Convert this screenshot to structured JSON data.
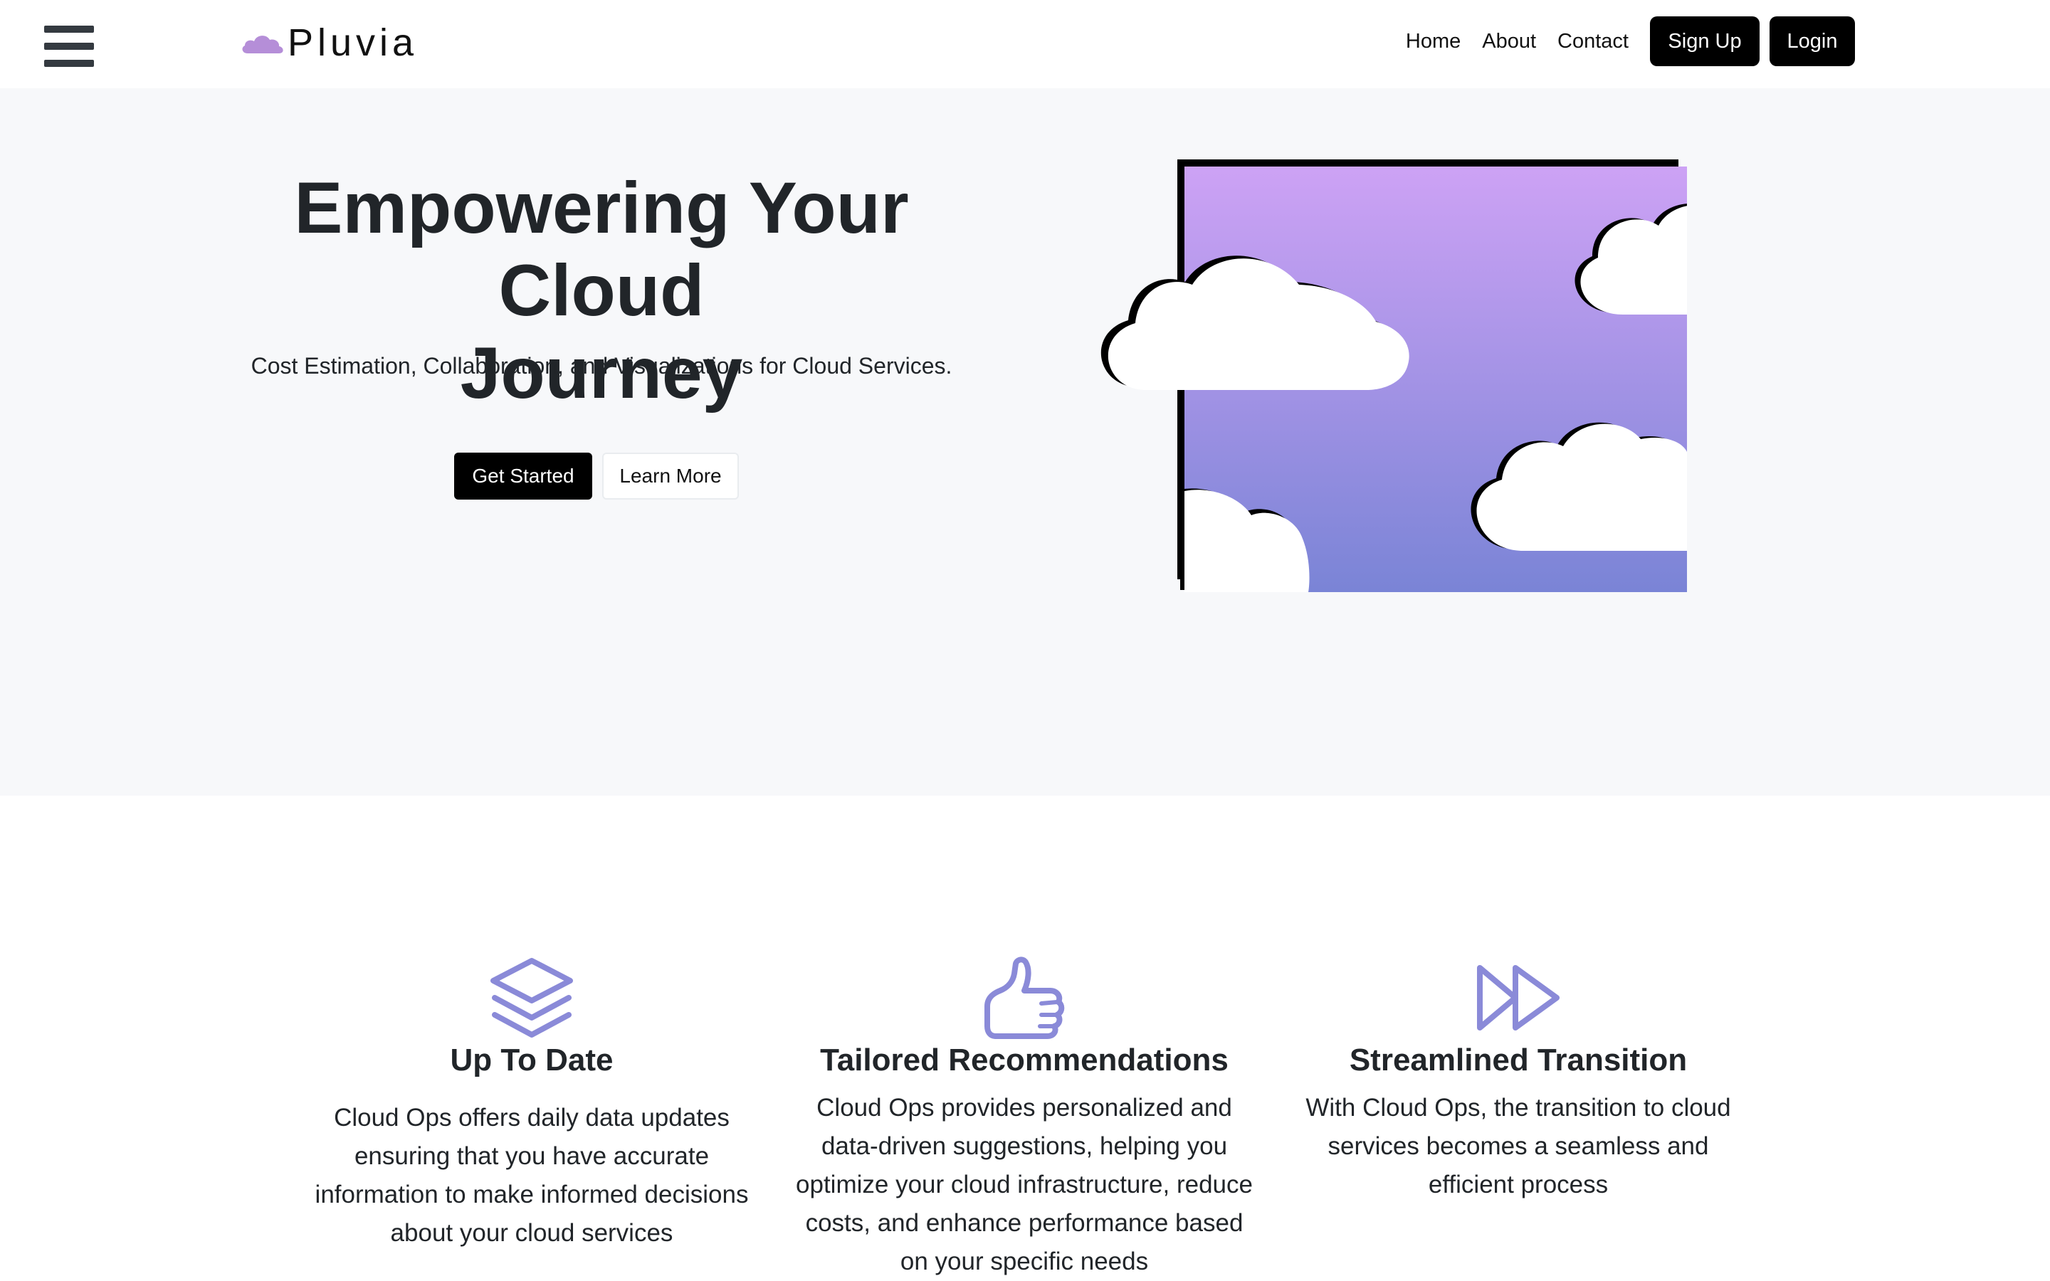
{
  "navbar": {
    "brand": "Pluvia",
    "links": [
      "Home",
      "About",
      "Contact"
    ],
    "signup_label": "Sign Up",
    "login_label": "Login"
  },
  "hero": {
    "title_line1": "Empowering Your Cloud",
    "title_line2": "Journey",
    "subtitle": "Cost Estimation, Collaboration, and Visualizations for Cloud Services.",
    "primary_button": "Get Started",
    "secondary_button": "Learn More"
  },
  "features": [
    {
      "icon": "layers-icon",
      "title": "Up To Date",
      "text": "Cloud Ops offers daily data updates ensuring that you have accurate information to make informed decisions about your cloud services"
    },
    {
      "icon": "thumbs-up-icon",
      "title": "Tailored Recommendations",
      "text": "Cloud Ops provides personalized and data-driven suggestions, helping you optimize your cloud infrastructure, reduce costs, and enhance performance based on your specific needs"
    },
    {
      "icon": "fast-forward-icon",
      "title": "Streamlined Transition",
      "text": "With Cloud Ops, the transition to cloud services becomes a seamless and efficient process"
    }
  ],
  "colors": {
    "accent": "#8a8ad8",
    "brand_cloud": "#b58ed8",
    "gradient_top": "#cda2f5",
    "gradient_bottom": "#7a84d6",
    "dark_button": "#000000",
    "hero_background": "#f7f8fa"
  }
}
